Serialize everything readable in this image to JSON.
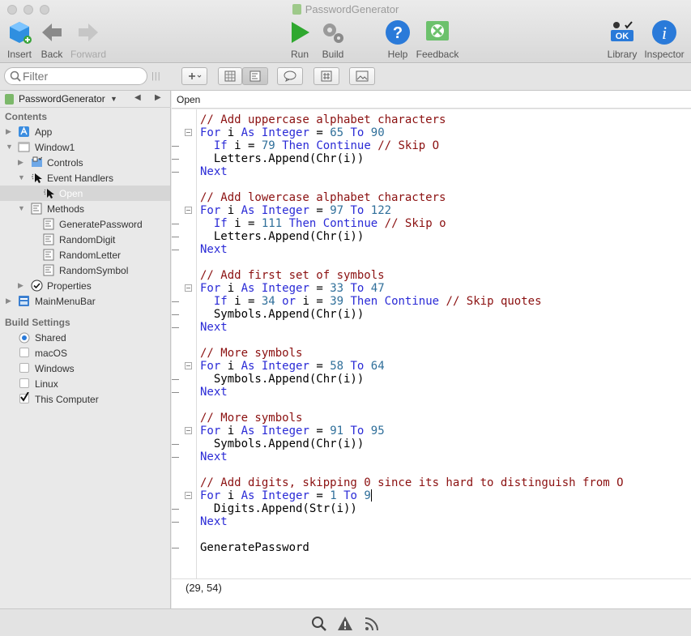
{
  "window": {
    "title": "PasswordGenerator"
  },
  "toolbar": [
    {
      "label": "Insert",
      "icon": "insert-cube-icon",
      "enabled": true
    },
    {
      "label": "Back",
      "icon": "back-arrow-icon",
      "enabled": true
    },
    {
      "label": "Forward",
      "icon": "forward-arrow-icon",
      "enabled": false
    },
    {
      "label": "Run",
      "icon": "run-play-icon",
      "enabled": true
    },
    {
      "label": "Build",
      "icon": "build-gears-icon",
      "enabled": true
    },
    {
      "label": "Help",
      "icon": "help-question-icon",
      "enabled": true
    },
    {
      "label": "Feedback",
      "icon": "feedback-icon",
      "enabled": true
    },
    {
      "label": "Library",
      "icon": "library-icon",
      "enabled": true
    },
    {
      "label": "Inspector",
      "icon": "inspector-info-icon",
      "enabled": true
    }
  ],
  "library_badge": "OK",
  "filter": {
    "placeholder": "Filter"
  },
  "sub_toolbar": {
    "add_label": "+"
  },
  "navigator": {
    "project": "PasswordGenerator",
    "contents_header": "Contents",
    "items": [
      {
        "label": "App"
      },
      {
        "label": "Window1"
      },
      {
        "label": "Controls"
      },
      {
        "label": "Event Handlers"
      },
      {
        "label": "Open",
        "selected": true
      },
      {
        "label": "Methods"
      },
      {
        "label": "GeneratePassword"
      },
      {
        "label": "RandomDigit"
      },
      {
        "label": "RandomLetter"
      },
      {
        "label": "RandomSymbol"
      },
      {
        "label": "Properties"
      },
      {
        "label": "MainMenuBar"
      }
    ],
    "build_header": "Build Settings",
    "build": [
      {
        "label": "Shared",
        "kind": "radio",
        "checked": true
      },
      {
        "label": "macOS",
        "kind": "checkbox",
        "checked": false
      },
      {
        "label": "Windows",
        "kind": "checkbox",
        "checked": false
      },
      {
        "label": "Linux",
        "kind": "checkbox",
        "checked": false
      },
      {
        "label": "This Computer",
        "kind": "checkbox",
        "checked": true
      }
    ]
  },
  "editor": {
    "header": "Open",
    "cursor": "(29, 54)",
    "code": [
      "// Add uppercase alphabet characters",
      "For i As Integer = 65 To 90",
      "  If i = 79 Then Continue // Skip O",
      "  Letters.Append(Chr(i))",
      "Next",
      "",
      "// Add lowercase alphabet characters",
      "For i As Integer = 97 To 122",
      "  If i = 111 Then Continue // Skip o",
      "  Letters.Append(Chr(i))",
      "Next",
      "",
      "// Add first set of symbols",
      "For i As Integer = 33 To 47",
      "  If i = 34 or i = 39 Then Continue // Skip quotes",
      "  Symbols.Append(Chr(i))",
      "Next",
      "",
      "// More symbols",
      "For i As Integer = 58 To 64",
      "  Symbols.Append(Chr(i))",
      "Next",
      "",
      "// More symbols",
      "For i As Integer = 91 To 95",
      "  Symbols.Append(Chr(i))",
      "Next",
      "",
      "// Add digits, skipping 0 since its hard to distinguish from O",
      "For i As Integer = 1 To 9",
      "  Digits.Append(Str(i))",
      "Next",
      "",
      "GeneratePassword"
    ]
  }
}
